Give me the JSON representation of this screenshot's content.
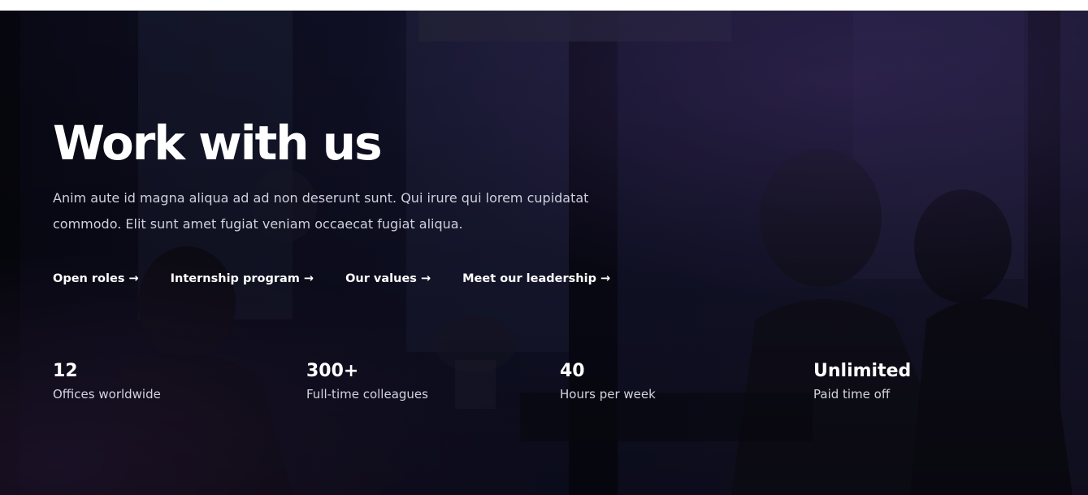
{
  "hero": {
    "title": "Work with us",
    "subtitle": "Anim aute id magna aliqua ad ad non deserunt sunt. Qui irure qui lorem cupidatat commodo. Elit sunt amet fugiat veniam occaecat fugiat aliqua.",
    "links": [
      {
        "label": "Open roles →"
      },
      {
        "label": "Internship program →"
      },
      {
        "label": "Our values →"
      },
      {
        "label": "Meet our leadership →"
      }
    ],
    "stats": [
      {
        "value": "12",
        "label": "Offices worldwide"
      },
      {
        "value": "300+",
        "label": "Full-time colleagues"
      },
      {
        "value": "40",
        "label": "Hours per week"
      },
      {
        "value": "Unlimited",
        "label": "Paid time off"
      }
    ]
  },
  "colors": {
    "background": "#0b0c1c",
    "overlay_purple": "#3a2a5e",
    "text_primary": "#ffffff",
    "text_secondary": "#cfd0dc"
  }
}
